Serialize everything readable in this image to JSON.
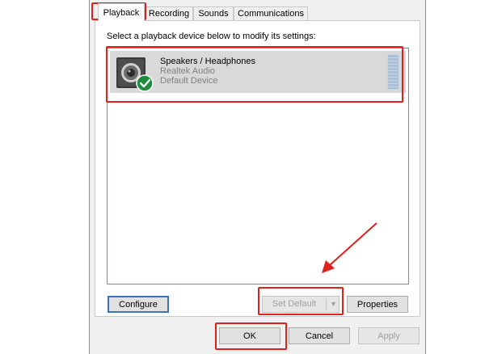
{
  "tabs": [
    {
      "label": "Playback",
      "active": true
    },
    {
      "label": "Recording",
      "active": false
    },
    {
      "label": "Sounds",
      "active": false
    },
    {
      "label": "Communications",
      "active": false
    }
  ],
  "instruction": "Select a playback device below to modify its settings:",
  "device": {
    "name": "Speakers / Headphones",
    "driver": "Realtek Audio",
    "status": "Default Device",
    "icon": "speaker-icon",
    "badge_icon": "green-checkmark-icon"
  },
  "buttons": {
    "configure": "Configure",
    "set_default": "Set Default",
    "properties": "Properties",
    "ok": "OK",
    "cancel": "Cancel",
    "apply": "Apply"
  },
  "colors": {
    "callout": "#e0201b",
    "selection": "#d9d9d9",
    "default_badge": "#1e8c3a",
    "focus_border": "#3b73c2"
  }
}
